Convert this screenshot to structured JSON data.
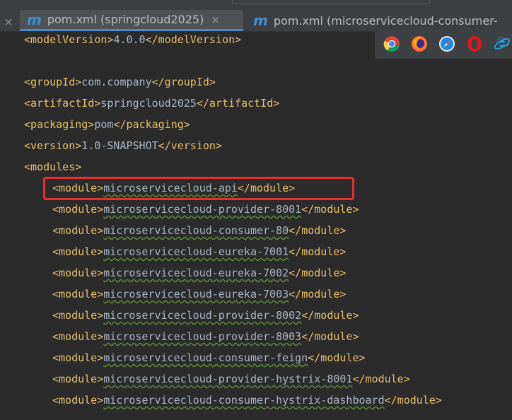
{
  "tabs": [
    {
      "icon": "m",
      "label": "pom.xml (springcloud2025)",
      "close": "×",
      "active": true
    },
    {
      "icon": "m",
      "label": "pom.xml (microservicecloud-consumer-",
      "active": false
    }
  ],
  "tabbar_left_close": "×",
  "browser_icons": [
    "chrome-icon",
    "firefox-icon",
    "safari-icon",
    "opera-icon",
    "ie-icon"
  ],
  "highlight_color": "#e8302a",
  "code_lines": [
    {
      "indent": 1,
      "open": "<modelVersion>",
      "text": "4.0.0",
      "close": "</modelVersion>"
    },
    {
      "indent": 0,
      "open": "",
      "text": "",
      "close": ""
    },
    {
      "indent": 1,
      "open": "<groupId>",
      "text": "com.company",
      "close": "</groupId>"
    },
    {
      "indent": 1,
      "open": "<artifactId>",
      "text": "springcloud2025",
      "close": "</artifactId>"
    },
    {
      "indent": 1,
      "open": "<packaging>",
      "text": "pom",
      "close": "</packaging>"
    },
    {
      "indent": 1,
      "open": "<version>",
      "text": "1.0-SNAPSHOT",
      "close": "</version>"
    },
    {
      "indent": 1,
      "open": "<modules>",
      "text": "",
      "close": ""
    },
    {
      "indent": 2,
      "open": "<module>",
      "text": "microservicecloud-api",
      "close": "</module>",
      "squiggle": true
    },
    {
      "indent": 2,
      "open": "<module>",
      "text": "microservicecloud-provider-8001",
      "close": "</module>",
      "squiggle": true
    },
    {
      "indent": 2,
      "open": "<module>",
      "text": "microservicecloud-consumer-80",
      "close": "</module>",
      "squiggle": true
    },
    {
      "indent": 2,
      "open": "<module>",
      "text": "microservicecloud-eureka-7001",
      "close": "</module>",
      "squiggle": true
    },
    {
      "indent": 2,
      "open": "<module>",
      "text": "microservicecloud-eureka-7002",
      "close": "</module>",
      "squiggle": true
    },
    {
      "indent": 2,
      "open": "<module>",
      "text": "microservicecloud-eureka-7003",
      "close": "</module>",
      "squiggle": true
    },
    {
      "indent": 2,
      "open": "<module>",
      "text": "microservicecloud-provider-8002",
      "close": "</module>",
      "squiggle": true
    },
    {
      "indent": 2,
      "open": "<module>",
      "text": "microservicecloud-provider-8003",
      "close": "</module>",
      "squiggle": true
    },
    {
      "indent": 2,
      "open": "<module>",
      "text": "microservicecloud-consumer-feign",
      "close": "</module>",
      "squiggle": true
    },
    {
      "indent": 2,
      "open": "<module>",
      "text": "microservicecloud-provider-hystrix-8001",
      "close": "</module>",
      "squiggle": true
    },
    {
      "indent": 2,
      "open": "<module>",
      "text": "microservicecloud-consumer-hystrix-dashboard",
      "close": "</module>",
      "squiggle": true
    }
  ]
}
